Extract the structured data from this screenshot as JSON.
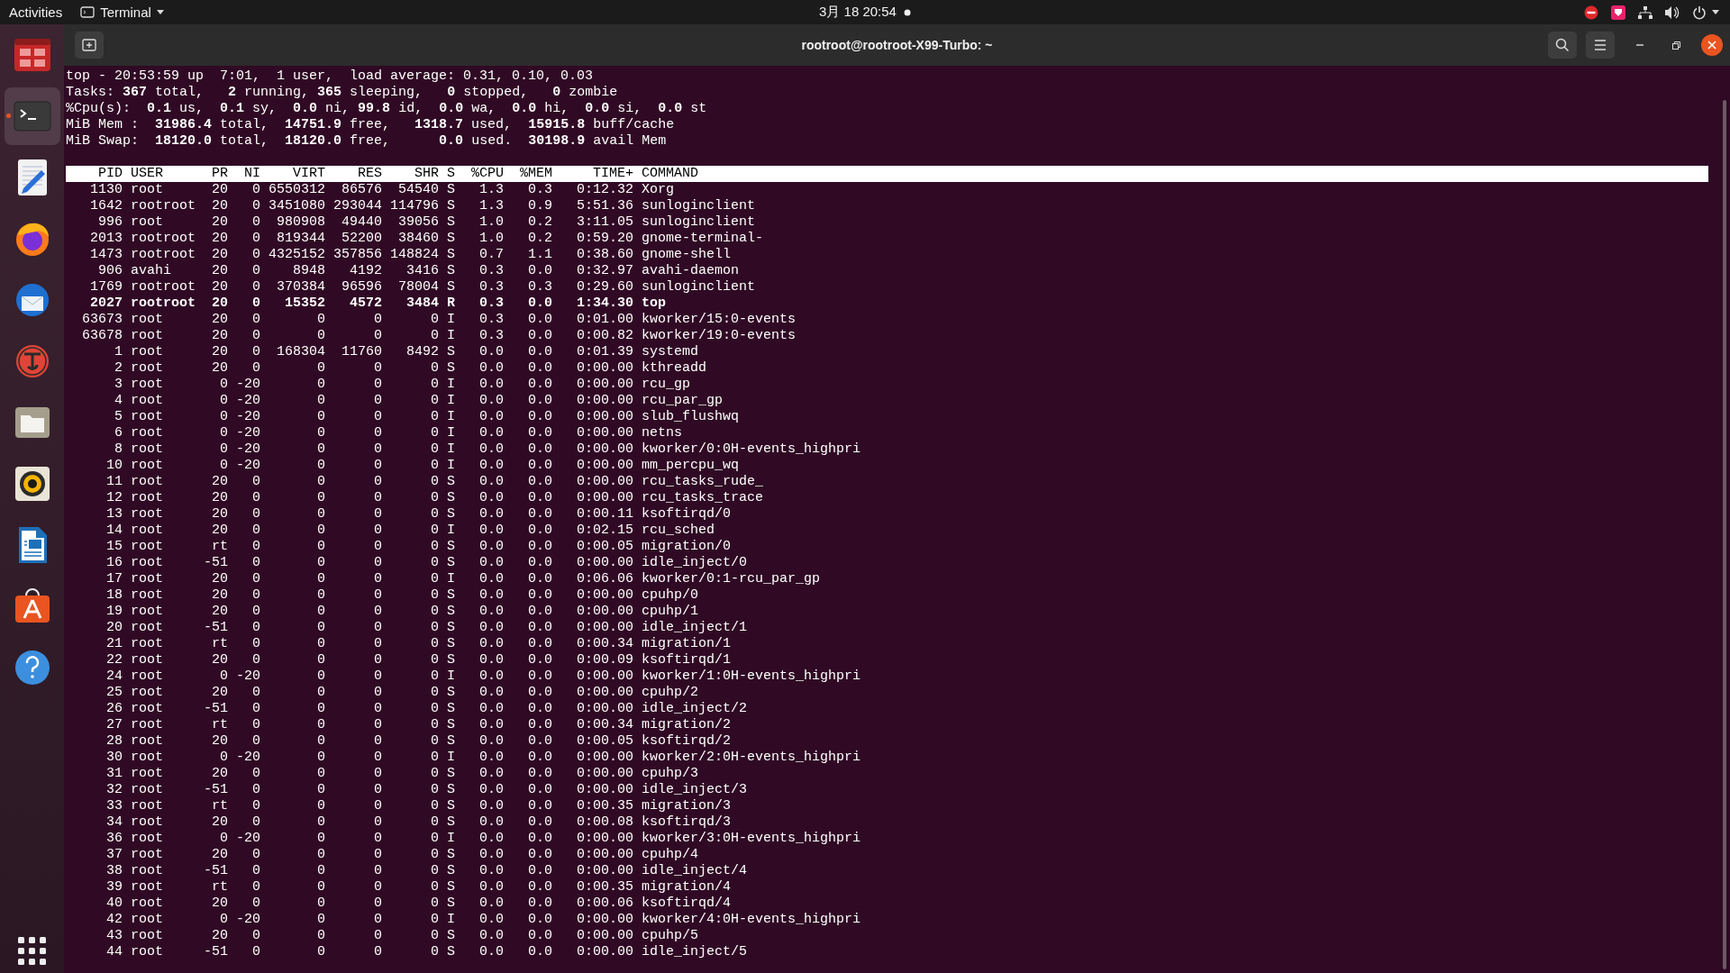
{
  "top_bar": {
    "activities": "Activities",
    "app_menu": "Terminal",
    "clock": "3月 18  20:54"
  },
  "dock": [
    {
      "kind": "screenshot",
      "selected": false,
      "running": false
    },
    {
      "kind": "terminal",
      "selected": true,
      "running": true
    },
    {
      "kind": "editor",
      "selected": false,
      "running": false
    },
    {
      "kind": "browser",
      "selected": false,
      "running": false
    },
    {
      "kind": "mail",
      "selected": false,
      "running": false
    },
    {
      "kind": "typora",
      "selected": false,
      "running": false
    },
    {
      "kind": "files",
      "selected": false,
      "running": false
    },
    {
      "kind": "music",
      "selected": false,
      "running": false
    },
    {
      "kind": "writer",
      "selected": false,
      "running": false
    },
    {
      "kind": "software",
      "selected": false,
      "running": false
    },
    {
      "kind": "help",
      "selected": false,
      "running": false
    }
  ],
  "window": {
    "title": "rootroot@rootroot-X99-Turbo: ~"
  },
  "terminal": {
    "summary": [
      "top - 20:53:59 up  7:01,  1 user,  load average: 0.31, 0.10, 0.03",
      "Tasks: **367** total,   **2** running, **365** sleeping,   **0** stopped,   **0** zombie",
      "%Cpu(s):  **0.1** us,  **0.1** sy,  **0.0** ni, **99.8** id,  **0.0** wa,  **0.0** hi,  **0.0** si,  **0.0** st",
      "MiB Mem :  **31986.4** total,  **14751.9** free,   **1318.7** used,  **15915.8** buff/cache",
      "MiB Swap:  **18120.0** total,  **18120.0** free,      **0.0** used.  **30198.9** avail Mem"
    ],
    "columns": [
      "PID",
      "USER",
      "PR",
      "NI",
      "VIRT",
      "RES",
      "SHR",
      "S",
      "%CPU",
      "%MEM",
      "TIME+",
      "COMMAND"
    ],
    "rows": [
      {
        "cells": [
          "1130",
          "root",
          "20",
          "0",
          "6550312",
          "86576",
          "54540",
          "S",
          "1.3",
          "0.3",
          "0:12.32",
          "Xorg"
        ],
        "highlighted": false
      },
      {
        "cells": [
          "1642",
          "rootroot",
          "20",
          "0",
          "3451080",
          "293044",
          "114796",
          "S",
          "1.3",
          "0.9",
          "5:51.36",
          "sunloginclient"
        ],
        "highlighted": false
      },
      {
        "cells": [
          "996",
          "root",
          "20",
          "0",
          "980908",
          "49440",
          "39056",
          "S",
          "1.0",
          "0.2",
          "3:11.05",
          "sunloginclient"
        ],
        "highlighted": false
      },
      {
        "cells": [
          "2013",
          "rootroot",
          "20",
          "0",
          "819344",
          "52200",
          "38460",
          "S",
          "1.0",
          "0.2",
          "0:59.20",
          "gnome-terminal-"
        ],
        "highlighted": false
      },
      {
        "cells": [
          "1473",
          "rootroot",
          "20",
          "0",
          "4325152",
          "357856",
          "148824",
          "S",
          "0.7",
          "1.1",
          "0:38.60",
          "gnome-shell"
        ],
        "highlighted": false
      },
      {
        "cells": [
          "906",
          "avahi",
          "20",
          "0",
          "8948",
          "4192",
          "3416",
          "S",
          "0.3",
          "0.0",
          "0:32.97",
          "avahi-daemon"
        ],
        "highlighted": false
      },
      {
        "cells": [
          "1769",
          "rootroot",
          "20",
          "0",
          "370384",
          "96596",
          "78004",
          "S",
          "0.3",
          "0.3",
          "0:29.60",
          "sunloginclient"
        ],
        "highlighted": false
      },
      {
        "cells": [
          "2027",
          "rootroot",
          "20",
          "0",
          "15352",
          "4572",
          "3484",
          "R",
          "0.3",
          "0.0",
          "1:34.30",
          "top"
        ],
        "highlighted": true
      },
      {
        "cells": [
          "63673",
          "root",
          "20",
          "0",
          "0",
          "0",
          "0",
          "I",
          "0.3",
          "0.0",
          "0:01.00",
          "kworker/15:0-events"
        ],
        "highlighted": false
      },
      {
        "cells": [
          "63678",
          "root",
          "20",
          "0",
          "0",
          "0",
          "0",
          "I",
          "0.3",
          "0.0",
          "0:00.82",
          "kworker/19:0-events"
        ],
        "highlighted": false
      },
      {
        "cells": [
          "1",
          "root",
          "20",
          "0",
          "168304",
          "11760",
          "8492",
          "S",
          "0.0",
          "0.0",
          "0:01.39",
          "systemd"
        ],
        "highlighted": false
      },
      {
        "cells": [
          "2",
          "root",
          "20",
          "0",
          "0",
          "0",
          "0",
          "S",
          "0.0",
          "0.0",
          "0:00.00",
          "kthreadd"
        ],
        "highlighted": false
      },
      {
        "cells": [
          "3",
          "root",
          "0",
          "-20",
          "0",
          "0",
          "0",
          "I",
          "0.0",
          "0.0",
          "0:00.00",
          "rcu_gp"
        ],
        "highlighted": false
      },
      {
        "cells": [
          "4",
          "root",
          "0",
          "-20",
          "0",
          "0",
          "0",
          "I",
          "0.0",
          "0.0",
          "0:00.00",
          "rcu_par_gp"
        ],
        "highlighted": false
      },
      {
        "cells": [
          "5",
          "root",
          "0",
          "-20",
          "0",
          "0",
          "0",
          "I",
          "0.0",
          "0.0",
          "0:00.00",
          "slub_flushwq"
        ],
        "highlighted": false
      },
      {
        "cells": [
          "6",
          "root",
          "0",
          "-20",
          "0",
          "0",
          "0",
          "I",
          "0.0",
          "0.0",
          "0:00.00",
          "netns"
        ],
        "highlighted": false
      },
      {
        "cells": [
          "8",
          "root",
          "0",
          "-20",
          "0",
          "0",
          "0",
          "I",
          "0.0",
          "0.0",
          "0:00.00",
          "kworker/0:0H-events_highpri"
        ],
        "highlighted": false
      },
      {
        "cells": [
          "10",
          "root",
          "0",
          "-20",
          "0",
          "0",
          "0",
          "I",
          "0.0",
          "0.0",
          "0:00.00",
          "mm_percpu_wq"
        ],
        "highlighted": false
      },
      {
        "cells": [
          "11",
          "root",
          "20",
          "0",
          "0",
          "0",
          "0",
          "S",
          "0.0",
          "0.0",
          "0:00.00",
          "rcu_tasks_rude_"
        ],
        "highlighted": false
      },
      {
        "cells": [
          "12",
          "root",
          "20",
          "0",
          "0",
          "0",
          "0",
          "S",
          "0.0",
          "0.0",
          "0:00.00",
          "rcu_tasks_trace"
        ],
        "highlighted": false
      },
      {
        "cells": [
          "13",
          "root",
          "20",
          "0",
          "0",
          "0",
          "0",
          "S",
          "0.0",
          "0.0",
          "0:00.11",
          "ksoftirqd/0"
        ],
        "highlighted": false
      },
      {
        "cells": [
          "14",
          "root",
          "20",
          "0",
          "0",
          "0",
          "0",
          "I",
          "0.0",
          "0.0",
          "0:02.15",
          "rcu_sched"
        ],
        "highlighted": false
      },
      {
        "cells": [
          "15",
          "root",
          "rt",
          "0",
          "0",
          "0",
          "0",
          "S",
          "0.0",
          "0.0",
          "0:00.05",
          "migration/0"
        ],
        "highlighted": false
      },
      {
        "cells": [
          "16",
          "root",
          "-51",
          "0",
          "0",
          "0",
          "0",
          "S",
          "0.0",
          "0.0",
          "0:00.00",
          "idle_inject/0"
        ],
        "highlighted": false
      },
      {
        "cells": [
          "17",
          "root",
          "20",
          "0",
          "0",
          "0",
          "0",
          "I",
          "0.0",
          "0.0",
          "0:06.06",
          "kworker/0:1-rcu_par_gp"
        ],
        "highlighted": false
      },
      {
        "cells": [
          "18",
          "root",
          "20",
          "0",
          "0",
          "0",
          "0",
          "S",
          "0.0",
          "0.0",
          "0:00.00",
          "cpuhp/0"
        ],
        "highlighted": false
      },
      {
        "cells": [
          "19",
          "root",
          "20",
          "0",
          "0",
          "0",
          "0",
          "S",
          "0.0",
          "0.0",
          "0:00.00",
          "cpuhp/1"
        ],
        "highlighted": false
      },
      {
        "cells": [
          "20",
          "root",
          "-51",
          "0",
          "0",
          "0",
          "0",
          "S",
          "0.0",
          "0.0",
          "0:00.00",
          "idle_inject/1"
        ],
        "highlighted": false
      },
      {
        "cells": [
          "21",
          "root",
          "rt",
          "0",
          "0",
          "0",
          "0",
          "S",
          "0.0",
          "0.0",
          "0:00.34",
          "migration/1"
        ],
        "highlighted": false
      },
      {
        "cells": [
          "22",
          "root",
          "20",
          "0",
          "0",
          "0",
          "0",
          "S",
          "0.0",
          "0.0",
          "0:00.09",
          "ksoftirqd/1"
        ],
        "highlighted": false
      },
      {
        "cells": [
          "24",
          "root",
          "0",
          "-20",
          "0",
          "0",
          "0",
          "I",
          "0.0",
          "0.0",
          "0:00.00",
          "kworker/1:0H-events_highpri"
        ],
        "highlighted": false
      },
      {
        "cells": [
          "25",
          "root",
          "20",
          "0",
          "0",
          "0",
          "0",
          "S",
          "0.0",
          "0.0",
          "0:00.00",
          "cpuhp/2"
        ],
        "highlighted": false
      },
      {
        "cells": [
          "26",
          "root",
          "-51",
          "0",
          "0",
          "0",
          "0",
          "S",
          "0.0",
          "0.0",
          "0:00.00",
          "idle_inject/2"
        ],
        "highlighted": false
      },
      {
        "cells": [
          "27",
          "root",
          "rt",
          "0",
          "0",
          "0",
          "0",
          "S",
          "0.0",
          "0.0",
          "0:00.34",
          "migration/2"
        ],
        "highlighted": false
      },
      {
        "cells": [
          "28",
          "root",
          "20",
          "0",
          "0",
          "0",
          "0",
          "S",
          "0.0",
          "0.0",
          "0:00.05",
          "ksoftirqd/2"
        ],
        "highlighted": false
      },
      {
        "cells": [
          "30",
          "root",
          "0",
          "-20",
          "0",
          "0",
          "0",
          "I",
          "0.0",
          "0.0",
          "0:00.00",
          "kworker/2:0H-events_highpri"
        ],
        "highlighted": false
      },
      {
        "cells": [
          "31",
          "root",
          "20",
          "0",
          "0",
          "0",
          "0",
          "S",
          "0.0",
          "0.0",
          "0:00.00",
          "cpuhp/3"
        ],
        "highlighted": false
      },
      {
        "cells": [
          "32",
          "root",
          "-51",
          "0",
          "0",
          "0",
          "0",
          "S",
          "0.0",
          "0.0",
          "0:00.00",
          "idle_inject/3"
        ],
        "highlighted": false
      },
      {
        "cells": [
          "33",
          "root",
          "rt",
          "0",
          "0",
          "0",
          "0",
          "S",
          "0.0",
          "0.0",
          "0:00.35",
          "migration/3"
        ],
        "highlighted": false
      },
      {
        "cells": [
          "34",
          "root",
          "20",
          "0",
          "0",
          "0",
          "0",
          "S",
          "0.0",
          "0.0",
          "0:00.08",
          "ksoftirqd/3"
        ],
        "highlighted": false
      },
      {
        "cells": [
          "36",
          "root",
          "0",
          "-20",
          "0",
          "0",
          "0",
          "I",
          "0.0",
          "0.0",
          "0:00.00",
          "kworker/3:0H-events_highpri"
        ],
        "highlighted": false
      },
      {
        "cells": [
          "37",
          "root",
          "20",
          "0",
          "0",
          "0",
          "0",
          "S",
          "0.0",
          "0.0",
          "0:00.00",
          "cpuhp/4"
        ],
        "highlighted": false
      },
      {
        "cells": [
          "38",
          "root",
          "-51",
          "0",
          "0",
          "0",
          "0",
          "S",
          "0.0",
          "0.0",
          "0:00.00",
          "idle_inject/4"
        ],
        "highlighted": false
      },
      {
        "cells": [
          "39",
          "root",
          "rt",
          "0",
          "0",
          "0",
          "0",
          "S",
          "0.0",
          "0.0",
          "0:00.35",
          "migration/4"
        ],
        "highlighted": false
      },
      {
        "cells": [
          "40",
          "root",
          "20",
          "0",
          "0",
          "0",
          "0",
          "S",
          "0.0",
          "0.0",
          "0:00.06",
          "ksoftirqd/4"
        ],
        "highlighted": false
      },
      {
        "cells": [
          "42",
          "root",
          "0",
          "-20",
          "0",
          "0",
          "0",
          "I",
          "0.0",
          "0.0",
          "0:00.00",
          "kworker/4:0H-events_highpri"
        ],
        "highlighted": false
      },
      {
        "cells": [
          "43",
          "root",
          "20",
          "0",
          "0",
          "0",
          "0",
          "S",
          "0.0",
          "0.0",
          "0:00.00",
          "cpuhp/5"
        ],
        "highlighted": false
      },
      {
        "cells": [
          "44",
          "root",
          "-51",
          "0",
          "0",
          "0",
          "0",
          "S",
          "0.0",
          "0.0",
          "0:00.00",
          "idle_inject/5"
        ],
        "highlighted": false
      }
    ]
  }
}
